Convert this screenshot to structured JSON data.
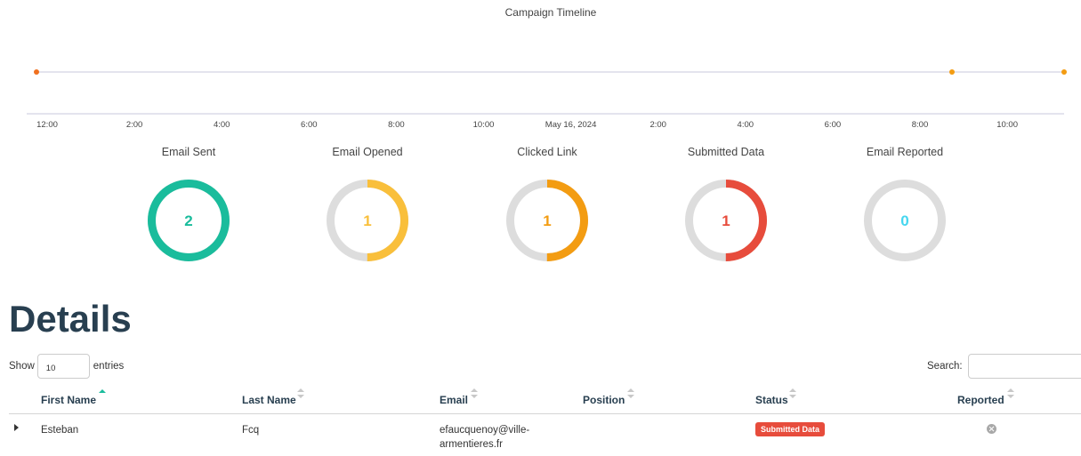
{
  "timeline": {
    "title": "Campaign Timeline",
    "tick_labels": [
      "12:00",
      "2:00",
      "4:00",
      "6:00",
      "8:00",
      "10:00",
      "May 16, 2024",
      "2:00",
      "4:00",
      "6:00",
      "8:00",
      "10:00"
    ],
    "colors": {
      "axis": "#c8c8dc",
      "event": "#f0701f",
      "event_light": "#f39c12"
    }
  },
  "stats": [
    {
      "label": "Email Sent",
      "value": "2",
      "fraction": 1.0,
      "color": "#1abc9c"
    },
    {
      "label": "Email Opened",
      "value": "1",
      "fraction": 0.5,
      "color": "#f9bf3b"
    },
    {
      "label": "Clicked Link",
      "value": "1",
      "fraction": 0.5,
      "color": "#f39c12"
    },
    {
      "label": "Submitted Data",
      "value": "1",
      "fraction": 0.5,
      "color": "#e74c3c"
    },
    {
      "label": "Email Reported",
      "value": "0",
      "fraction": 0,
      "color": "#45d6ef"
    }
  ],
  "ring_track_color": "#dddddd",
  "details": {
    "heading": "Details",
    "show_label": "Show",
    "entries_value": "10",
    "entries_label": "entries",
    "search_label": "Search:",
    "search_value": "",
    "columns": [
      "First Name",
      "Last Name",
      "Email",
      "Position",
      "Status",
      "Reported"
    ],
    "sort_active_color": "#1abc9c",
    "rows": [
      {
        "first_name": "Esteban",
        "last_name": "Fcq",
        "email_line1": "efaucquenoy@ville-",
        "email_line2": "armentieres.fr",
        "position": "",
        "status": "Submitted Data",
        "status_color": "#e74c3c",
        "reported_icon": "times-circle-icon"
      }
    ]
  }
}
